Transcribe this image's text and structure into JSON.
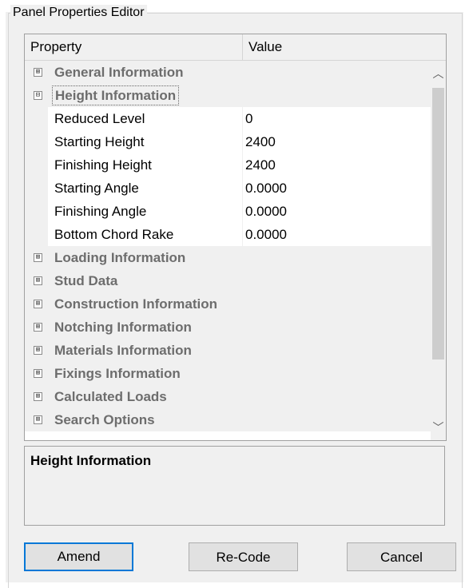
{
  "window": {
    "group_title": "Panel Properties Editor"
  },
  "grid": {
    "header": {
      "property": "Property",
      "value": "Value"
    },
    "rows": [
      {
        "kind": "category",
        "label": "General Information",
        "expander": "⊞"
      },
      {
        "kind": "category",
        "label": "Height Information",
        "expander": "⊟",
        "selected": true
      },
      {
        "kind": "property",
        "name": "Reduced Level",
        "value": "0"
      },
      {
        "kind": "property",
        "name": "Starting Height",
        "value": "2400"
      },
      {
        "kind": "property",
        "name": "Finishing Height",
        "value": "2400"
      },
      {
        "kind": "property",
        "name": "Starting Angle",
        "value": "0.0000"
      },
      {
        "kind": "property",
        "name": "Finishing Angle",
        "value": "0.0000"
      },
      {
        "kind": "property",
        "name": "Bottom Chord Rake",
        "value": "0.0000"
      },
      {
        "kind": "category",
        "label": "Loading Information",
        "expander": "⊞"
      },
      {
        "kind": "category",
        "label": "Stud Data",
        "expander": "⊞"
      },
      {
        "kind": "category",
        "label": "Construction Information",
        "expander": "⊞"
      },
      {
        "kind": "category",
        "label": "Notching Information",
        "expander": "⊞"
      },
      {
        "kind": "category",
        "label": "Materials Information",
        "expander": "⊞"
      },
      {
        "kind": "category",
        "label": "Fixings Information",
        "expander": "⊞"
      },
      {
        "kind": "category",
        "label": "Calculated Loads",
        "expander": "⊞"
      },
      {
        "kind": "category",
        "label": "Search Options",
        "expander": "⊞"
      }
    ],
    "scroll": {
      "up_icon": "chevron-up-icon",
      "down_icon": "chevron-down-icon",
      "up_glyph": "︿",
      "down_glyph": "﹀"
    }
  },
  "description": {
    "title": "Height Information"
  },
  "buttons": {
    "amend": "Amend",
    "recode": "Re-Code",
    "cancel": "Cancel"
  }
}
